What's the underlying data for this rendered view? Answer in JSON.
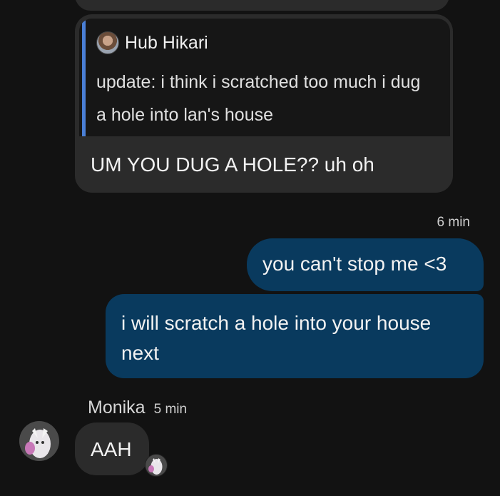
{
  "quoted_message": {
    "author": "Hub Hikari",
    "text": "update: i think i scratched too much i dug a hole into lan's house"
  },
  "incoming_reply": {
    "text": "UM YOU DUG A HOLE?? uh oh"
  },
  "outgoing_group": {
    "timestamp": "6 min",
    "messages": [
      "you can't stop me <3",
      "i will scratch a hole into your house next"
    ]
  },
  "next_message": {
    "sender": "Monika",
    "timestamp": "5 min",
    "text": "AAH"
  },
  "icons": {
    "quote_avatar": "user-avatar-icon",
    "sender_avatar": "user-avatar-icon",
    "read_receipt_avatar": "user-avatar-icon"
  },
  "colors": {
    "background": "#121212",
    "incoming_bubble": "#2b2b2b",
    "outgoing_bubble": "#093a5e",
    "quote_bar": "#4a7fd6"
  }
}
